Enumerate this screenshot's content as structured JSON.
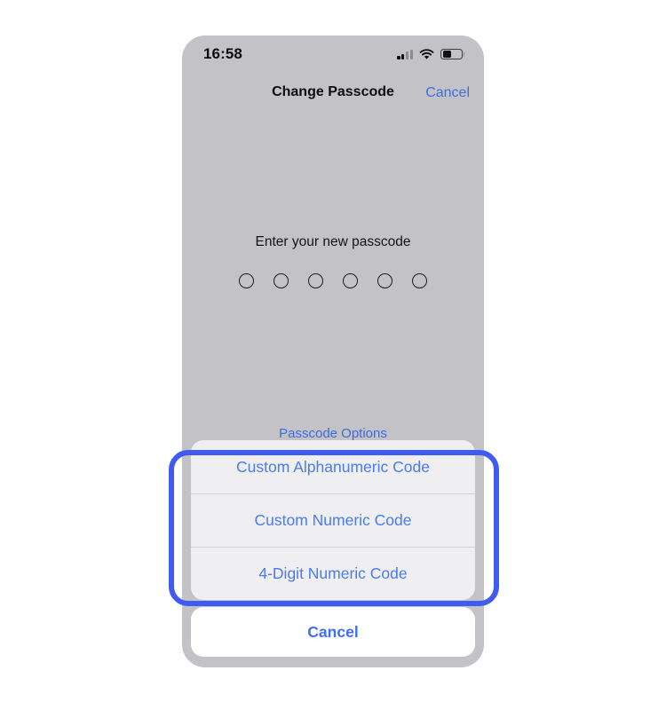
{
  "status_bar": {
    "time": "16:58",
    "cellular_icon": "cellular-signal-icon",
    "cellular_bars_filled": 2,
    "cellular_bars_total": 4,
    "wifi_icon": "wifi-icon",
    "battery_icon": "battery-icon",
    "battery_level_percent": 40
  },
  "nav_bar": {
    "title": "Change Passcode",
    "cancel_label": "Cancel"
  },
  "passcode": {
    "prompt": "Enter your new passcode",
    "dot_count": 6,
    "dots_filled": 0,
    "options_link": "Passcode Options"
  },
  "action_sheet": {
    "items": [
      {
        "label": "Custom Alphanumeric Code"
      },
      {
        "label": "Custom Numeric Code"
      },
      {
        "label": "4-Digit Numeric Code"
      }
    ],
    "cancel_label": "Cancel"
  },
  "colors": {
    "screen_background": "#c2c2c7",
    "sheet_background": "#efeff1",
    "ios_blue": "#4a7bf0",
    "highlight_border": "#3f5bf2",
    "cancel_white": "#ffffff"
  }
}
